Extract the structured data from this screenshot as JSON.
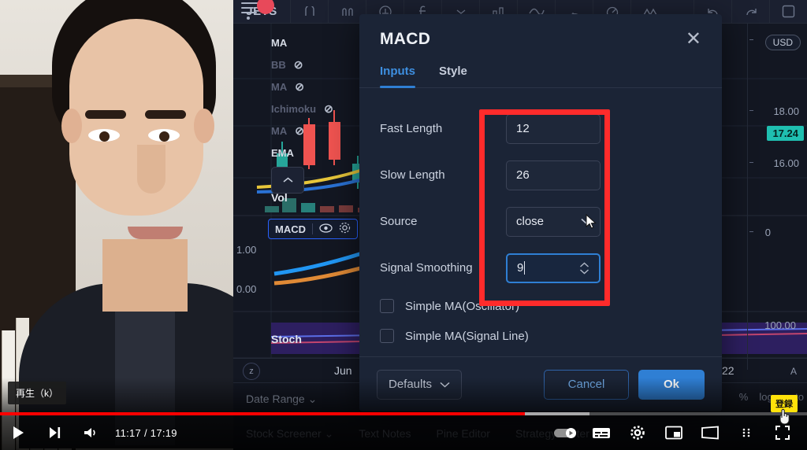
{
  "chart": {
    "symbol": "JETS",
    "notification_count": "",
    "legend_items": [
      {
        "label": "MA",
        "hidden": false
      },
      {
        "label": "BB",
        "hidden": true
      },
      {
        "label": "MA",
        "hidden": true
      },
      {
        "label": "Ichimoku",
        "hidden": true
      },
      {
        "label": "MA",
        "hidden": true
      },
      {
        "label": "EMA",
        "hidden": false
      }
    ],
    "volume_label": "Vol",
    "macd_legend_label": "MACD",
    "stoch_label": "Stoch",
    "macd_scale": [
      "1.00",
      "0.00"
    ],
    "price_scale": {
      "currency_badge": "USD",
      "ticks": [
        "18.00",
        "16.00",
        "0"
      ],
      "current_price": "17.24",
      "stoch_top": "100.00"
    },
    "time_axis": {
      "z_button": "z",
      "month": "Jun",
      "day": "22",
      "alert": "A"
    },
    "bottom_bar": {
      "date_range": "Date Range",
      "stock_screener": "Stock Screener",
      "text_notes": "Text Notes",
      "pine_editor": "Pine Editor",
      "strategy_tester": "Strategy Tester"
    },
    "scale_options": [
      "%",
      "log",
      "auto"
    ]
  },
  "modal": {
    "title": "MACD",
    "close_label": "✕",
    "tabs": [
      {
        "label": "Inputs",
        "active": true
      },
      {
        "label": "Style",
        "active": false
      }
    ],
    "fields": [
      {
        "label": "Fast Length",
        "value": "12",
        "type": "number"
      },
      {
        "label": "Slow Length",
        "value": "26",
        "type": "number"
      },
      {
        "label": "Source",
        "value": "close",
        "type": "select"
      },
      {
        "label": "Signal Smoothing",
        "value": "9",
        "type": "number-focused"
      }
    ],
    "checkboxes": [
      {
        "label": "Simple MA(Oscillator)",
        "checked": false
      },
      {
        "label": "Simple MA(Signal Line)",
        "checked": false
      }
    ],
    "footer": {
      "defaults": "Defaults",
      "cancel": "Cancel",
      "ok": "Ok"
    },
    "accent_color": "#2f7fd4",
    "annotation_color": "#ff2b2b"
  },
  "player": {
    "tooltip": "再生（k）",
    "time": "11:17 / 17:19",
    "subscribe_button": "登録",
    "progress_percent": 65
  }
}
